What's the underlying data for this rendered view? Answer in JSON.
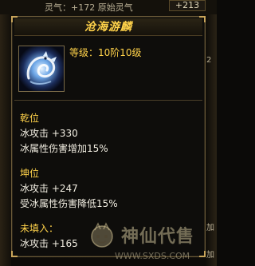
{
  "background": {
    "top_label": "灵气：+172 原始灵气",
    "top_value": "+213",
    "right_fragments": [
      "2",
      "加",
      "加"
    ]
  },
  "tooltip": {
    "title": "沧海游麟",
    "icon": "dragon-icon",
    "grade": "等级：10阶10级",
    "sections": [
      {
        "name": "乾位",
        "lines": [
          "冰攻击 +330",
          "冰属性伤害增加15%"
        ]
      },
      {
        "name": "坤位",
        "lines": [
          "冰攻击 +247",
          "受冰属性伤害降低15%"
        ]
      },
      {
        "name": "未填入：",
        "lines": [
          "冰攻击 +165"
        ]
      }
    ]
  },
  "watermark": {
    "brand": "神仙代售",
    "site": "WWW.SXDS.COM"
  },
  "colors": {
    "title": "#ffd24a",
    "text_white": "#f2eee2",
    "border": "#6b5a38"
  }
}
